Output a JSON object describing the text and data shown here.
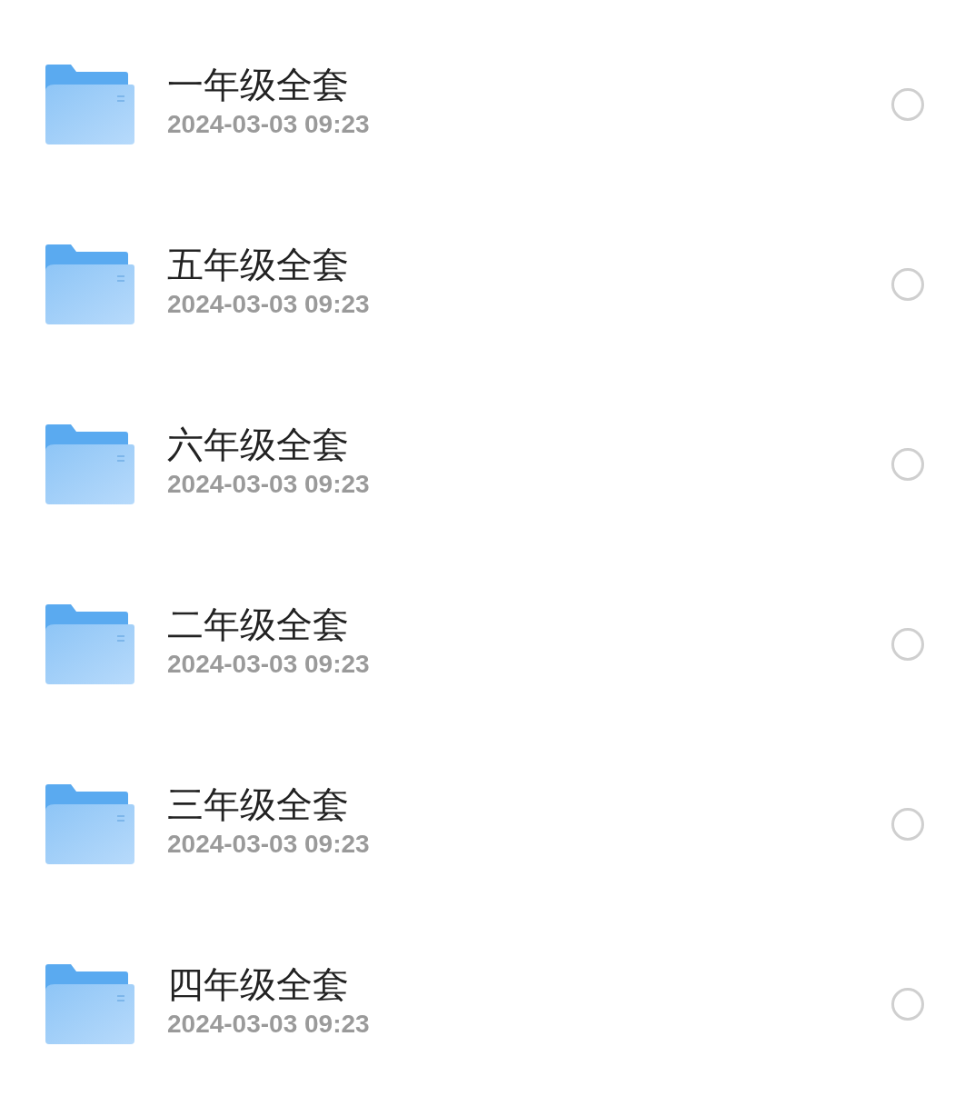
{
  "folders": [
    {
      "name": "一年级全套",
      "modified": "2024-03-03 09:23",
      "selected": false
    },
    {
      "name": "五年级全套",
      "modified": "2024-03-03 09:23",
      "selected": false
    },
    {
      "name": "六年级全套",
      "modified": "2024-03-03 09:23",
      "selected": false
    },
    {
      "name": "二年级全套",
      "modified": "2024-03-03 09:23",
      "selected": false
    },
    {
      "name": "三年级全套",
      "modified": "2024-03-03 09:23",
      "selected": false
    },
    {
      "name": "四年级全套",
      "modified": "2024-03-03 09:23",
      "selected": false
    }
  ]
}
